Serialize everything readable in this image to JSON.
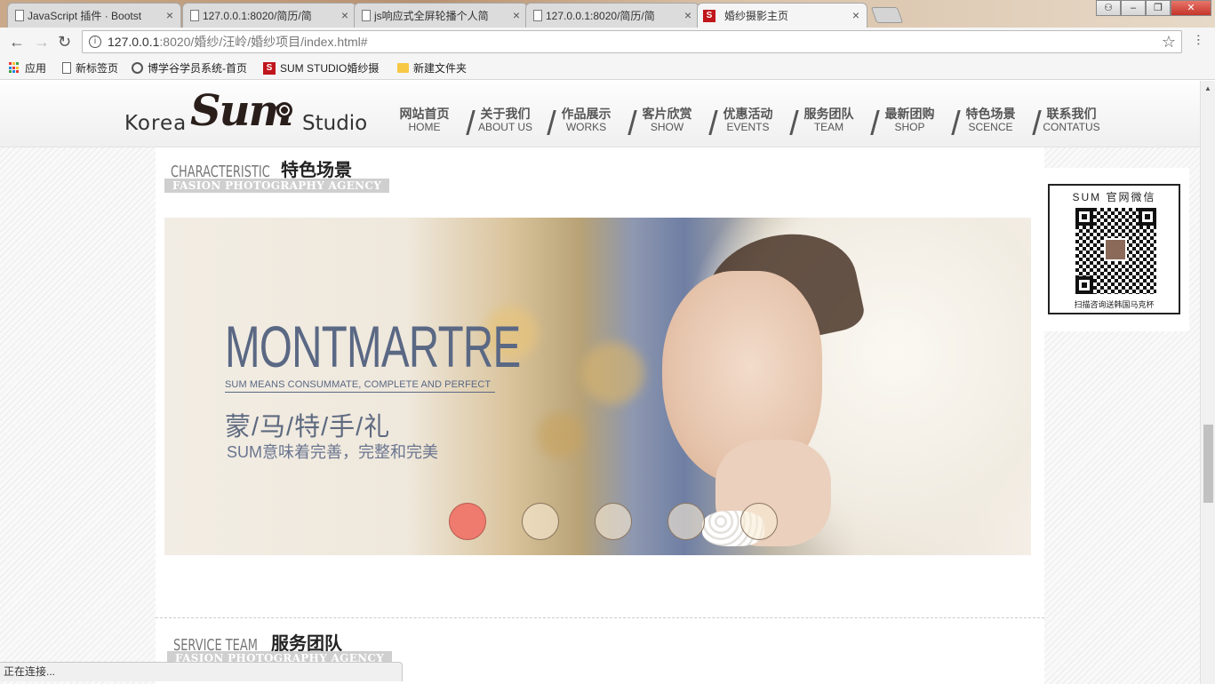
{
  "browser": {
    "tabs": [
      {
        "title": "JavaScript 插件 · Bootst",
        "favicon": "page-icon",
        "active": false
      },
      {
        "title": "127.0.0.1:8020/简历/简",
        "favicon": "page-icon",
        "active": false
      },
      {
        "title": "js响应式全屏轮播个人简",
        "favicon": "page-icon",
        "active": false
      },
      {
        "title": "127.0.0.1:8020/简历/简",
        "favicon": "page-icon",
        "active": false
      },
      {
        "title": "婚纱摄影主页",
        "favicon": "s-icon",
        "active": true
      }
    ],
    "address": {
      "host": "127.0.0.1",
      "path": ":8020/婚纱/汪岭/婚纱项目/index.html#"
    },
    "bookmarks": [
      {
        "label": "应用",
        "icon": "apps-icon"
      },
      {
        "label": "新标签页",
        "icon": "page-icon"
      },
      {
        "label": "博学谷学员系统-首页",
        "icon": "circle-icon"
      },
      {
        "label": "SUM STUDIO婚纱摄",
        "icon": "s-icon"
      },
      {
        "label": "新建文件夹",
        "icon": "folder-icon"
      }
    ],
    "status": "正在连接..."
  },
  "site": {
    "logo": {
      "left": "Korea",
      "brand": "Sum",
      "right": "Studio"
    },
    "nav": [
      {
        "cn": "网站首页",
        "en": "HOME"
      },
      {
        "cn": "关于我们",
        "en": "ABOUT US"
      },
      {
        "cn": "作品展示",
        "en": "WORKS"
      },
      {
        "cn": "客片欣赏",
        "en": "SHOW"
      },
      {
        "cn": "优惠活动",
        "en": "EVENTS"
      },
      {
        "cn": "服务团队",
        "en": "TEAM"
      },
      {
        "cn": "最新团购",
        "en": "SHOP"
      },
      {
        "cn": "特色场景",
        "en": "SCENCE"
      },
      {
        "cn": "联系我们",
        "en": "CONTATUS"
      }
    ],
    "section1": {
      "en": "CHARACTERISTIC",
      "cn": "特色场景",
      "badge": "FASION PHOTOGRAPHY AGENCY"
    },
    "carousel": {
      "title": "MONTMARTRE",
      "tagline": "SUM MEANS CONSUMMATE, COMPLETE AND PERFECT",
      "cn_title": "蒙/马/特/手/礼",
      "subtitle": "SUM意味着完善，完整和完美",
      "dots": 5,
      "active_dot": 0
    },
    "section2": {
      "en": "SERVICE TEAM",
      "cn": "服务团队",
      "badge": "FASION PHOTOGRAPHY AGENCY"
    },
    "qr": {
      "title": "SUM 官网微信",
      "caption": "扫描咨询送韩国马克杯"
    }
  }
}
